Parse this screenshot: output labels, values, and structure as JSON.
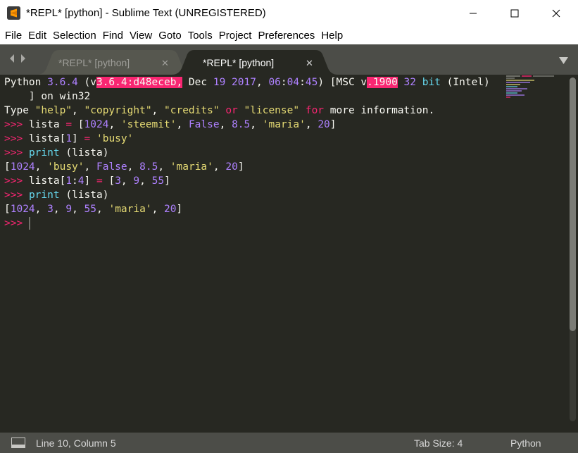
{
  "window": {
    "title": "*REPL* [python] - Sublime Text (UNREGISTERED)",
    "app_icon": "sublime-text-logo"
  },
  "menu": [
    "File",
    "Edit",
    "Selection",
    "Find",
    "View",
    "Goto",
    "Tools",
    "Project",
    "Preferences",
    "Help"
  ],
  "tabs": [
    {
      "label": "*REPL* [python]",
      "active": false
    },
    {
      "label": "*REPL* [python]",
      "active": true
    }
  ],
  "tab_close_glyph": "✕",
  "repl_lines": [
    [
      [
        "Python ",
        ""
      ],
      [
        "3.6.4",
        "num"
      ],
      [
        " (v",
        ""
      ],
      [
        "3.6.4:d48eceb,",
        "hl"
      ],
      [
        " Dec ",
        ""
      ],
      [
        "19",
        "num"
      ],
      [
        " ",
        ""
      ],
      [
        "2017",
        "num"
      ],
      [
        ", ",
        ""
      ],
      [
        "06",
        "num"
      ],
      [
        ":",
        ""
      ],
      [
        "04",
        "num"
      ],
      [
        ":",
        ""
      ],
      [
        "45",
        "num"
      ],
      [
        ") [MSC v",
        ""
      ],
      [
        ".1900",
        "hl"
      ],
      [
        " ",
        ""
      ],
      [
        "32",
        "num"
      ],
      [
        " ",
        ""
      ],
      [
        "bit",
        "fn"
      ],
      [
        " (Intel)",
        ""
      ]
    ],
    [
      [
        "    ] on win32",
        ""
      ]
    ],
    [
      [
        "Type ",
        ""
      ],
      [
        "\"help\"",
        "str"
      ],
      [
        ", ",
        ""
      ],
      [
        "\"copyright\"",
        "str"
      ],
      [
        ", ",
        ""
      ],
      [
        "\"credits\"",
        "str"
      ],
      [
        " ",
        ""
      ],
      [
        "or",
        "kw"
      ],
      [
        " ",
        ""
      ],
      [
        "\"license\"",
        "str"
      ],
      [
        " ",
        ""
      ],
      [
        "for",
        "kw"
      ],
      [
        " more information.",
        ""
      ]
    ],
    [
      [
        ">>>",
        "prompt"
      ],
      [
        " lista ",
        ""
      ],
      [
        "=",
        "kw"
      ],
      [
        " [",
        ""
      ],
      [
        "1024",
        "num"
      ],
      [
        ", ",
        ""
      ],
      [
        "'steemit'",
        "str"
      ],
      [
        ", ",
        ""
      ],
      [
        "False",
        "num"
      ],
      [
        ", ",
        ""
      ],
      [
        "8.5",
        "num"
      ],
      [
        ", ",
        ""
      ],
      [
        "'maria'",
        "str"
      ],
      [
        ", ",
        ""
      ],
      [
        "20",
        "num"
      ],
      [
        "]",
        ""
      ]
    ],
    [
      [
        ">>>",
        "prompt"
      ],
      [
        " lista[",
        ""
      ],
      [
        "1",
        "num"
      ],
      [
        "] ",
        ""
      ],
      [
        "=",
        "kw"
      ],
      [
        " ",
        ""
      ],
      [
        "'busy'",
        "str"
      ]
    ],
    [
      [
        ">>>",
        "prompt"
      ],
      [
        " ",
        ""
      ],
      [
        "print",
        "fn"
      ],
      [
        " (lista)",
        ""
      ]
    ],
    [
      [
        "[",
        ""
      ],
      [
        "1024",
        "num"
      ],
      [
        ", ",
        ""
      ],
      [
        "'busy'",
        "str"
      ],
      [
        ", ",
        ""
      ],
      [
        "False",
        "num"
      ],
      [
        ", ",
        ""
      ],
      [
        "8.5",
        "num"
      ],
      [
        ", ",
        ""
      ],
      [
        "'maria'",
        "str"
      ],
      [
        ", ",
        ""
      ],
      [
        "20",
        "num"
      ],
      [
        "]",
        ""
      ]
    ],
    [
      [
        ">>>",
        "prompt"
      ],
      [
        " lista[",
        ""
      ],
      [
        "1",
        "num"
      ],
      [
        ":",
        ""
      ],
      [
        "4",
        "num"
      ],
      [
        "] ",
        ""
      ],
      [
        "=",
        "kw"
      ],
      [
        " [",
        ""
      ],
      [
        "3",
        "num"
      ],
      [
        ", ",
        ""
      ],
      [
        "9",
        "num"
      ],
      [
        ", ",
        ""
      ],
      [
        "55",
        "num"
      ],
      [
        "]",
        ""
      ]
    ],
    [
      [
        ">>>",
        "prompt"
      ],
      [
        " ",
        ""
      ],
      [
        "print",
        "fn"
      ],
      [
        " (lista)",
        ""
      ]
    ],
    [
      [
        "[",
        ""
      ],
      [
        "1024",
        "num"
      ],
      [
        ", ",
        ""
      ],
      [
        "3",
        "num"
      ],
      [
        ", ",
        ""
      ],
      [
        "9",
        "num"
      ],
      [
        ", ",
        ""
      ],
      [
        "55",
        "num"
      ],
      [
        ", ",
        ""
      ],
      [
        "'maria'",
        "str"
      ],
      [
        ", ",
        ""
      ],
      [
        "20",
        "num"
      ],
      [
        "]",
        ""
      ]
    ],
    [
      [
        ">>>",
        "prompt"
      ],
      [
        " ",
        ""
      ],
      [
        "",
        "cursor"
      ]
    ]
  ],
  "status": {
    "position": "Line 10, Column 5",
    "tab_size": "Tab Size: 4",
    "syntax": "Python"
  },
  "colors": {
    "editor_bg": "#272822",
    "chrome_bg": "#4c4d48",
    "keyword": "#f92672",
    "number": "#ae81ff",
    "string": "#e6db74",
    "function": "#66d9ef",
    "highlight_bg": "#f92672"
  },
  "icons": {
    "minimize": "minimize-icon",
    "maximize": "maximize-icon",
    "close": "close-icon",
    "nav_left": "chevron-left-icon",
    "nav_right": "chevron-right-icon",
    "tab_dropdown": "triangle-down-icon",
    "status_panel": "panel-toggle-icon"
  }
}
